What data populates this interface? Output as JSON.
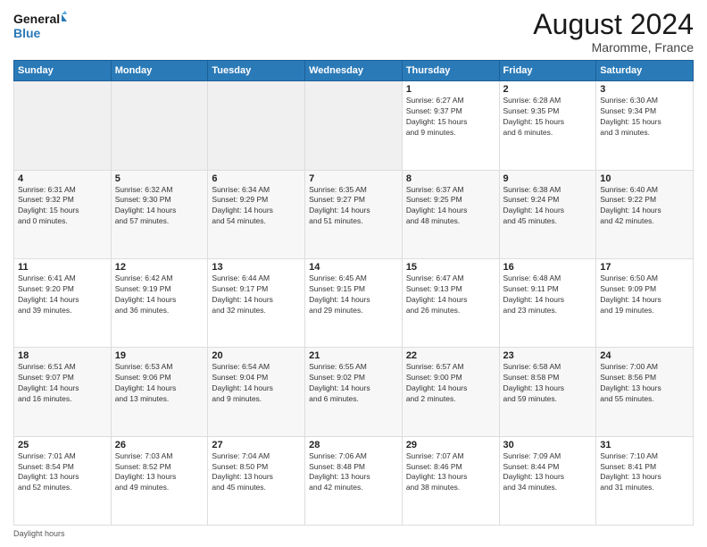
{
  "header": {
    "logo_line1": "General",
    "logo_line2": "Blue",
    "month_title": "August 2024",
    "subtitle": "Maromme, France"
  },
  "footer": {
    "daylight_label": "Daylight hours"
  },
  "weekdays": [
    "Sunday",
    "Monday",
    "Tuesday",
    "Wednesday",
    "Thursday",
    "Friday",
    "Saturday"
  ],
  "weeks": [
    [
      {
        "day": "",
        "info": ""
      },
      {
        "day": "",
        "info": ""
      },
      {
        "day": "",
        "info": ""
      },
      {
        "day": "",
        "info": ""
      },
      {
        "day": "1",
        "info": "Sunrise: 6:27 AM\nSunset: 9:37 PM\nDaylight: 15 hours\nand 9 minutes."
      },
      {
        "day": "2",
        "info": "Sunrise: 6:28 AM\nSunset: 9:35 PM\nDaylight: 15 hours\nand 6 minutes."
      },
      {
        "day": "3",
        "info": "Sunrise: 6:30 AM\nSunset: 9:34 PM\nDaylight: 15 hours\nand 3 minutes."
      }
    ],
    [
      {
        "day": "4",
        "info": "Sunrise: 6:31 AM\nSunset: 9:32 PM\nDaylight: 15 hours\nand 0 minutes."
      },
      {
        "day": "5",
        "info": "Sunrise: 6:32 AM\nSunset: 9:30 PM\nDaylight: 14 hours\nand 57 minutes."
      },
      {
        "day": "6",
        "info": "Sunrise: 6:34 AM\nSunset: 9:29 PM\nDaylight: 14 hours\nand 54 minutes."
      },
      {
        "day": "7",
        "info": "Sunrise: 6:35 AM\nSunset: 9:27 PM\nDaylight: 14 hours\nand 51 minutes."
      },
      {
        "day": "8",
        "info": "Sunrise: 6:37 AM\nSunset: 9:25 PM\nDaylight: 14 hours\nand 48 minutes."
      },
      {
        "day": "9",
        "info": "Sunrise: 6:38 AM\nSunset: 9:24 PM\nDaylight: 14 hours\nand 45 minutes."
      },
      {
        "day": "10",
        "info": "Sunrise: 6:40 AM\nSunset: 9:22 PM\nDaylight: 14 hours\nand 42 minutes."
      }
    ],
    [
      {
        "day": "11",
        "info": "Sunrise: 6:41 AM\nSunset: 9:20 PM\nDaylight: 14 hours\nand 39 minutes."
      },
      {
        "day": "12",
        "info": "Sunrise: 6:42 AM\nSunset: 9:19 PM\nDaylight: 14 hours\nand 36 minutes."
      },
      {
        "day": "13",
        "info": "Sunrise: 6:44 AM\nSunset: 9:17 PM\nDaylight: 14 hours\nand 32 minutes."
      },
      {
        "day": "14",
        "info": "Sunrise: 6:45 AM\nSunset: 9:15 PM\nDaylight: 14 hours\nand 29 minutes."
      },
      {
        "day": "15",
        "info": "Sunrise: 6:47 AM\nSunset: 9:13 PM\nDaylight: 14 hours\nand 26 minutes."
      },
      {
        "day": "16",
        "info": "Sunrise: 6:48 AM\nSunset: 9:11 PM\nDaylight: 14 hours\nand 23 minutes."
      },
      {
        "day": "17",
        "info": "Sunrise: 6:50 AM\nSunset: 9:09 PM\nDaylight: 14 hours\nand 19 minutes."
      }
    ],
    [
      {
        "day": "18",
        "info": "Sunrise: 6:51 AM\nSunset: 9:07 PM\nDaylight: 14 hours\nand 16 minutes."
      },
      {
        "day": "19",
        "info": "Sunrise: 6:53 AM\nSunset: 9:06 PM\nDaylight: 14 hours\nand 13 minutes."
      },
      {
        "day": "20",
        "info": "Sunrise: 6:54 AM\nSunset: 9:04 PM\nDaylight: 14 hours\nand 9 minutes."
      },
      {
        "day": "21",
        "info": "Sunrise: 6:55 AM\nSunset: 9:02 PM\nDaylight: 14 hours\nand 6 minutes."
      },
      {
        "day": "22",
        "info": "Sunrise: 6:57 AM\nSunset: 9:00 PM\nDaylight: 14 hours\nand 2 minutes."
      },
      {
        "day": "23",
        "info": "Sunrise: 6:58 AM\nSunset: 8:58 PM\nDaylight: 13 hours\nand 59 minutes."
      },
      {
        "day": "24",
        "info": "Sunrise: 7:00 AM\nSunset: 8:56 PM\nDaylight: 13 hours\nand 55 minutes."
      }
    ],
    [
      {
        "day": "25",
        "info": "Sunrise: 7:01 AM\nSunset: 8:54 PM\nDaylight: 13 hours\nand 52 minutes."
      },
      {
        "day": "26",
        "info": "Sunrise: 7:03 AM\nSunset: 8:52 PM\nDaylight: 13 hours\nand 49 minutes."
      },
      {
        "day": "27",
        "info": "Sunrise: 7:04 AM\nSunset: 8:50 PM\nDaylight: 13 hours\nand 45 minutes."
      },
      {
        "day": "28",
        "info": "Sunrise: 7:06 AM\nSunset: 8:48 PM\nDaylight: 13 hours\nand 42 minutes."
      },
      {
        "day": "29",
        "info": "Sunrise: 7:07 AM\nSunset: 8:46 PM\nDaylight: 13 hours\nand 38 minutes."
      },
      {
        "day": "30",
        "info": "Sunrise: 7:09 AM\nSunset: 8:44 PM\nDaylight: 13 hours\nand 34 minutes."
      },
      {
        "day": "31",
        "info": "Sunrise: 7:10 AM\nSunset: 8:41 PM\nDaylight: 13 hours\nand 31 minutes."
      }
    ]
  ]
}
